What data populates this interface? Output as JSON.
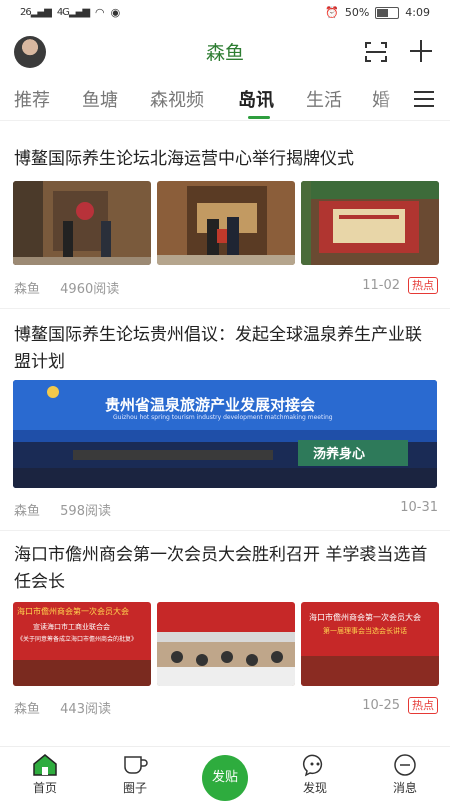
{
  "status": {
    "network1": "26",
    "network2": "4G",
    "battery": "50%",
    "time": "4:09"
  },
  "header": {
    "title": "森鱼"
  },
  "tabs": [
    "推荐",
    "鱼塘",
    "森视频",
    "岛讯",
    "生活",
    "婚"
  ],
  "active_tab": "岛讯",
  "articles": [
    {
      "title": "博鳌国际养生论坛北海运营中心举行揭牌仪式",
      "source": "森鱼",
      "reads": "4960阅读",
      "date": "11-02",
      "badge": "热点"
    },
    {
      "title": "博鳌国际养生论坛贵州倡议：发起全球温泉养生产业联盟计划",
      "source": "森鱼",
      "reads": "598阅读",
      "date": "10-31",
      "badge": "",
      "image_text": {
        "main": "贵州省温泉旅游产业发展对接会",
        "sub": "Guizhou hot spring tourism industry development matchmaking meeting",
        "slogan": "汤养身心"
      }
    },
    {
      "title": "海口市儋州商会第一次会员大会胜利召开 羊学裘当选首任会长",
      "source": "森鱼",
      "reads": "443阅读",
      "date": "10-25",
      "badge": "热点",
      "image_text": {
        "banner1": "海口市儋州商会第一次会员大会",
        "banner1_sub": "宣读海口市工商业联合会",
        "banner1_sub2": "《关于同意筹备成立海口市儋州商会的批复》",
        "banner3": "海口市儋州商会第一次会员大会",
        "banner3_sub": "第一届理事会当选会长讲话"
      }
    }
  ],
  "bottom_nav": {
    "home": "首页",
    "circle": "圈子",
    "post": "发贴",
    "discover": "发现",
    "messages": "消息"
  },
  "colors": {
    "brand_green": "#2e7d32",
    "accent_green": "#2eac3e",
    "hot_red": "#e53935"
  }
}
